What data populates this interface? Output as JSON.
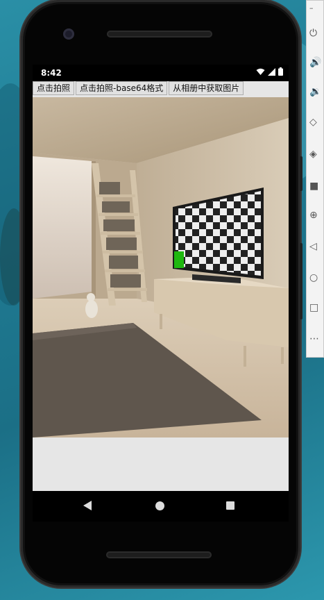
{
  "status_bar": {
    "time": "8:42",
    "icons": [
      "wifi-icon",
      "cellular-icon",
      "battery-icon"
    ]
  },
  "app": {
    "buttons": [
      {
        "label": "点击拍照"
      },
      {
        "label": "点击拍照-base64格式"
      },
      {
        "label": "从相册中获取图片"
      }
    ],
    "photo": {
      "scene": "virtual-room-with-tv-checkerboard",
      "marker_color": "#1fb80f"
    }
  },
  "nav_bar": {
    "buttons": [
      "back-icon",
      "home-icon",
      "recents-icon"
    ]
  },
  "emulator_toolbar": {
    "icons": [
      "power-icon",
      "volume-up-icon",
      "volume-down-icon",
      "rotate-left-icon",
      "rotate-right-icon",
      "camera-icon",
      "zoom-icon",
      "back-icon",
      "home-icon",
      "overview-icon",
      "more-icon"
    ]
  },
  "colors": {
    "background": "#1f7a92",
    "button_bg": "#e1e1e1",
    "app_bg": "#e6e6e6"
  }
}
